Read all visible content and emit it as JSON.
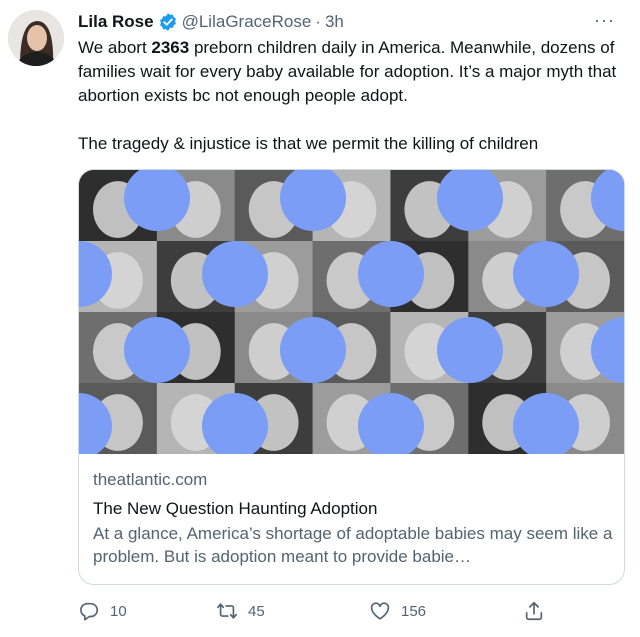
{
  "tweet": {
    "author_name": "Lila Rose",
    "handle": "@LilaGraceRose",
    "separator": "·",
    "time": "3h",
    "more_label": "···",
    "text_part1_a": "We abort ",
    "text_part1_bold": "2363",
    "text_part1_b": " preborn children daily in America. Meanwhile, dozens of families wait for every baby available for adoption. It’s a major myth that abortion exists bc not enough people adopt.",
    "text_part2": "The tragedy & injustice is that we permit the killing of children"
  },
  "card": {
    "domain": "theatlantic.com",
    "title": "The New Question Haunting Adoption",
    "description": "At a glance, America’s shortage of adoptable babies may seem like a problem. But is adoption meant to provide babie…"
  },
  "actions": {
    "reply_count": "10",
    "retweet_count": "45",
    "like_count": "156"
  },
  "colors": {
    "verified": "#1d9bf0",
    "dot_overlay": "#7b9df5",
    "muted_text": "#536471"
  }
}
